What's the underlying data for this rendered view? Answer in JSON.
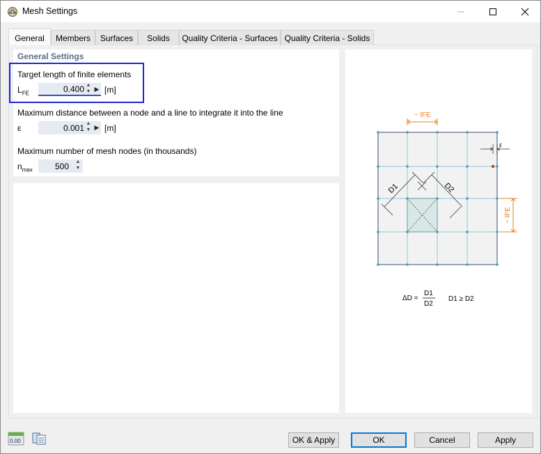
{
  "window": {
    "title": "Mesh Settings"
  },
  "tabs": [
    {
      "label": "General"
    },
    {
      "label": "Members"
    },
    {
      "label": "Surfaces"
    },
    {
      "label": "Solids"
    },
    {
      "label": "Quality Criteria - Surfaces"
    },
    {
      "label": "Quality Criteria - Solids"
    }
  ],
  "general": {
    "section_title": "General Settings",
    "target_length": {
      "label": "Target length of finite elements",
      "symbol": "L",
      "symbol_sub": "FE",
      "value": "0.400",
      "unit": "[m]"
    },
    "max_distance": {
      "label": "Maximum distance between a node and a line to integrate it into the line",
      "symbol": "ε",
      "value": "0.001",
      "unit": "[m]"
    },
    "max_nodes": {
      "label": "Maximum number of mesh nodes (in thousands)",
      "symbol": "n",
      "symbol_sub": "max",
      "value": "500"
    }
  },
  "diagram": {
    "lfe_top": "~ lFE",
    "lfe_side": "~ lFE",
    "epsilon": "ε",
    "d1": "D1",
    "d2": "D2",
    "formula_lhs": "ΔD =",
    "formula_num": "D1",
    "formula_den": "D2",
    "formula_cond": "D1 ≥ D2"
  },
  "footer": {
    "ok_apply": "OK & Apply",
    "ok": "OK",
    "cancel": "Cancel",
    "apply": "Apply",
    "units_icon_text": "0.00"
  },
  "colors": {
    "accent": "#1a24d6",
    "section_title": "#5a6f8a",
    "dimension": "#e8801a",
    "mesh_line": "#7fc3d6",
    "node": "#4a9ab0"
  }
}
